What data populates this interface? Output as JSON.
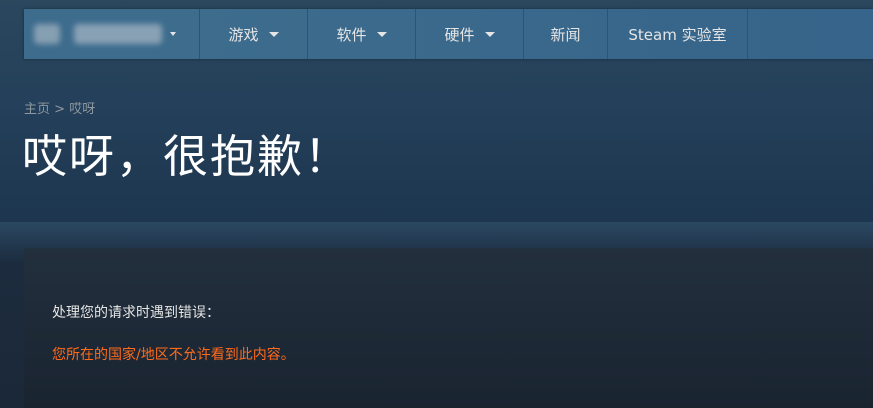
{
  "nav": {
    "items": [
      {
        "label": "游戏",
        "has_dropdown": true
      },
      {
        "label": "软件",
        "has_dropdown": true
      },
      {
        "label": "硬件",
        "has_dropdown": true
      },
      {
        "label": "新闻",
        "has_dropdown": false
      },
      {
        "label": "Steam 实验室",
        "has_dropdown": false
      }
    ],
    "account_blurred": true
  },
  "breadcrumb": {
    "home": "主页",
    "separator": ">",
    "current": "哎呀"
  },
  "page": {
    "title": "哎呀，很抱歉！"
  },
  "error": {
    "intro": "处理您的请求时遇到错误：",
    "message": "您所在的国家/地区不允许看到此内容。"
  },
  "colors": {
    "nav_background": "#3d6c8d",
    "page_background": "#1b2838",
    "error_text": "#ff6a1a",
    "breadcrumb_text": "#8f98a0"
  }
}
